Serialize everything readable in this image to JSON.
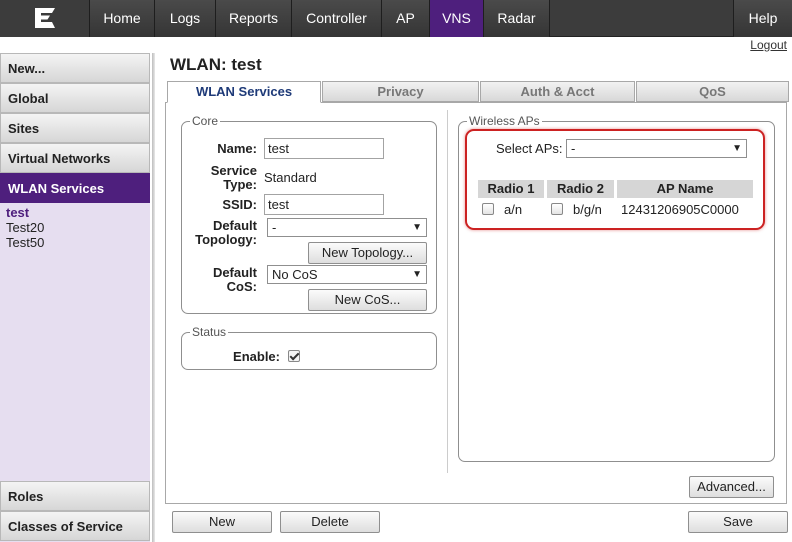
{
  "nav": {
    "logo_icon": "extreme-logo-icon",
    "tabs": [
      {
        "label": "Home"
      },
      {
        "label": "Logs"
      },
      {
        "label": "Reports"
      },
      {
        "label": "Controller"
      },
      {
        "label": "AP"
      },
      {
        "label": "VNS",
        "active": true
      },
      {
        "label": "Radar"
      }
    ],
    "help": "Help",
    "logout": "Logout",
    "colors": {
      "bar": "#3c3c3c",
      "active": "#4e1f7d"
    }
  },
  "sidebar": {
    "items": [
      {
        "label": "New..."
      },
      {
        "label": "Global"
      },
      {
        "label": "Sites"
      },
      {
        "label": "Virtual Networks"
      },
      {
        "label": "WLAN Services",
        "active": true
      }
    ],
    "sub_items": [
      "test",
      "Test20",
      "Test50"
    ],
    "bottom_items": [
      {
        "label": "Roles"
      },
      {
        "label": "Classes of Service"
      }
    ],
    "colors": {
      "active": "#4e1f7d",
      "sub_bg": "#e6def0"
    }
  },
  "main": {
    "title": "WLAN: test",
    "tabs": [
      {
        "label": "WLAN Services",
        "active": true
      },
      {
        "label": "Privacy"
      },
      {
        "label": "Auth & Acct"
      },
      {
        "label": "QoS"
      }
    ],
    "core": {
      "legend": "Core",
      "name_label": "Name:",
      "name_value": "test",
      "service_type_label_1": "Service",
      "service_type_label_2": "Type:",
      "service_type_value": "Standard",
      "ssid_label": "SSID:",
      "ssid_value": "test",
      "default_topology_label_1": "Default",
      "default_topology_label_2": "Topology:",
      "default_topology_value": "-",
      "new_topology_button": "New Topology...",
      "default_cos_label_1": "Default",
      "default_cos_label_2": "CoS:",
      "default_cos_value": "No CoS",
      "new_cos_button": "New CoS..."
    },
    "status": {
      "legend": "Status",
      "enable_label": "Enable:",
      "enabled": true
    },
    "wireless_aps": {
      "legend": "Wireless APs",
      "select_label": "Select APs:",
      "select_value": "-",
      "columns": [
        "Radio 1",
        "Radio 2",
        "AP Name"
      ],
      "rows": [
        {
          "radio1": "a/n",
          "radio1_checked": false,
          "radio2": "b/g/n",
          "radio2_checked": false,
          "ap_name": "12431206905C0000"
        }
      ],
      "highlight_color": "#cc2222"
    },
    "advanced_button": "Advanced...",
    "footer": {
      "new_button": "New",
      "delete_button": "Delete",
      "save_button": "Save"
    }
  }
}
